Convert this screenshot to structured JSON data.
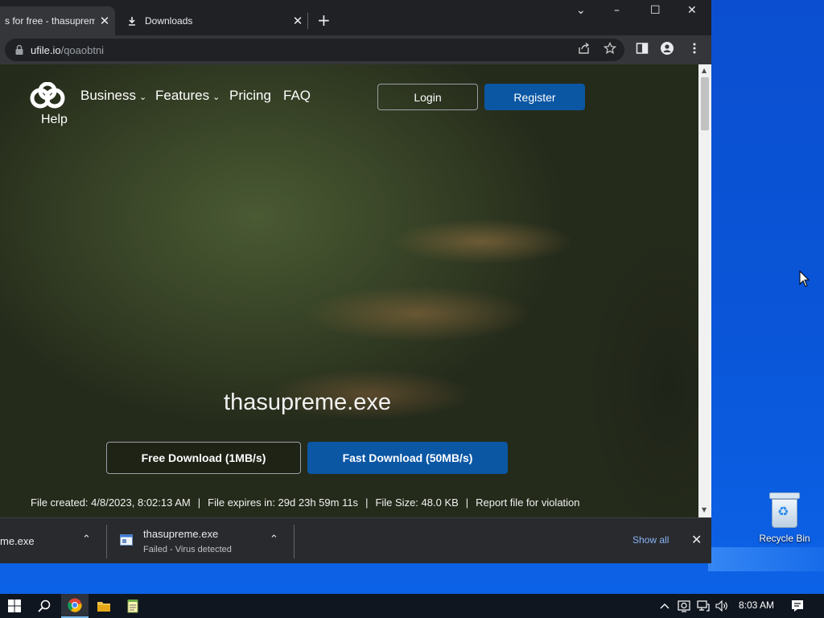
{
  "browser": {
    "tabs": [
      {
        "title": "s for free - thasupreme.exe",
        "close": "✕"
      },
      {
        "title": "Downloads",
        "close": "✕"
      }
    ],
    "new_tab": "+",
    "window_controls": {
      "dropdown": "⌄",
      "minimize": "–",
      "maximize": "☐",
      "close": "✕"
    },
    "address": {
      "host": "ufile.io",
      "path": "/qoaobtni"
    },
    "toolbar_icons": [
      "share-icon",
      "star-icon",
      "side-panel-icon",
      "profile-icon",
      "menu-icon"
    ]
  },
  "page": {
    "nav": {
      "business": "Business",
      "features": "Features",
      "pricing": "Pricing",
      "faq": "FAQ",
      "help": "Help",
      "chevron": "⌄"
    },
    "login": "Login",
    "register": "Register",
    "filename": "thasupreme.exe",
    "free_download": "Free Download (1MB/s)",
    "fast_download": "Fast Download (50MB/s)",
    "file_info": {
      "created": "File created: 4/8/2023, 8:02:13 AM",
      "expires": "File expires in: 29d 23h 59m 11s",
      "size": "File Size: 48.0 KB",
      "report": "Report file for violation",
      "separator": "|"
    },
    "colors": {
      "accent": "#0b57a4",
      "link": "#8ab4f8"
    }
  },
  "downloads_shelf": {
    "items": [
      {
        "name": "me.exe"
      },
      {
        "name": "thasupreme.exe",
        "status": "Failed - Virus detected"
      }
    ],
    "show_all": "Show all",
    "close": "✕",
    "chevron": "⌃"
  },
  "desktop": {
    "recycle_bin": "Recycle Bin"
  },
  "taskbar": {
    "apps": [
      "start-icon",
      "search-icon",
      "chrome-icon",
      "file-explorer-icon",
      "notepad-icon"
    ],
    "time": "8:03 AM",
    "tray": [
      "chevron-up-icon",
      "security-icon",
      "network-icon",
      "volume-icon",
      "notifications-icon"
    ]
  }
}
